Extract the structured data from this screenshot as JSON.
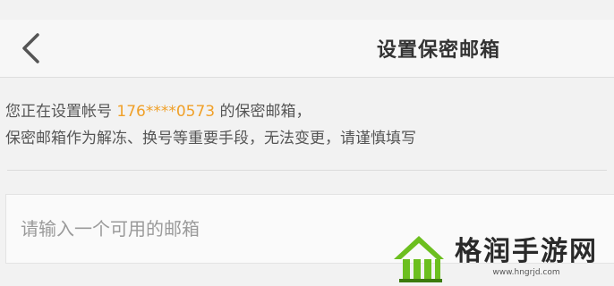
{
  "header": {
    "title": "设置保密邮箱",
    "back_icon": "chevron-left-icon"
  },
  "info": {
    "line1_prefix": "您正在设置帐号",
    "account": "176****0573",
    "line1_suffix": "的保密邮箱，",
    "line2": "保密邮箱作为解冻、换号等重要手段，无法变更，请谨慎填写"
  },
  "email_input": {
    "placeholder": "请输入一个可用的邮箱",
    "value": ""
  },
  "watermark": {
    "name": "格润手游网",
    "url": "www.hngrjd.com",
    "color": "#6cbf1f"
  }
}
